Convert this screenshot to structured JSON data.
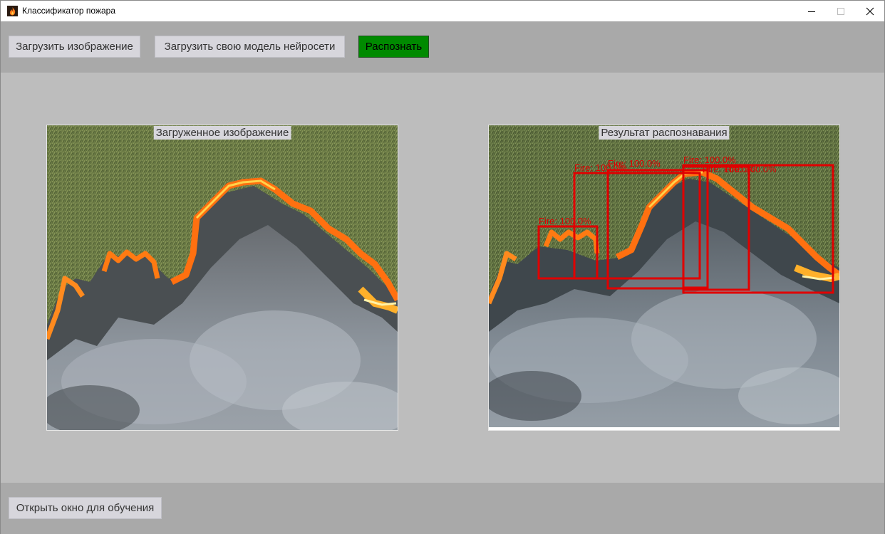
{
  "window": {
    "title": "Классификатор пожара",
    "app_icon": "fire-icon",
    "controls": [
      "minimize-icon",
      "maximize-icon",
      "close-icon"
    ]
  },
  "toolbar": {
    "load_image_label": "Загрузить изображение",
    "load_model_label": "Загрузить свою модель нейросети",
    "recognize_label": "Распознать",
    "recognize_color": "#008a00"
  },
  "panels": {
    "source": {
      "label": "Загруженное изображение"
    },
    "result": {
      "label": "Результат распознавания",
      "box_color": "#e00000",
      "detections": [
        {
          "label": "Fire: 100.0%"
        },
        {
          "label": "Fire: 100.0%"
        },
        {
          "label": "Fire: 100.0%"
        },
        {
          "label": "Fire: 100.0%"
        },
        {
          "label": "Fire: 100.0%"
        },
        {
          "label": "Fire: 100.0%"
        }
      ]
    }
  },
  "footer": {
    "open_training_label": "Открыть окно для обучения"
  }
}
